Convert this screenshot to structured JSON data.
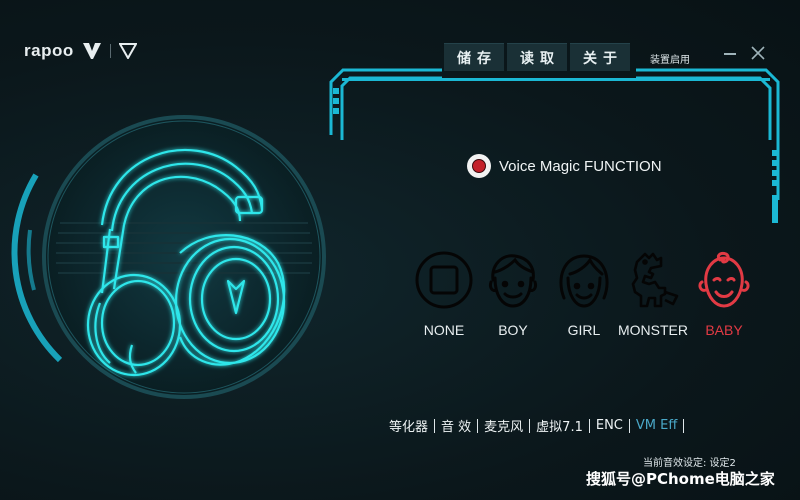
{
  "brand": {
    "name": "rapoo"
  },
  "toolbar": {
    "save_label": "储存",
    "load_label": "读取",
    "about_label": "关于",
    "device_status": "装置启用"
  },
  "voice_magic": {
    "label": "Voice Magic FUNCTION",
    "enabled": true
  },
  "presets": [
    {
      "id": "none",
      "label": "NONE",
      "icon": "none-icon",
      "selected": false
    },
    {
      "id": "boy",
      "label": "BOY",
      "icon": "boy-face-icon",
      "selected": false
    },
    {
      "id": "girl",
      "label": "GIRL",
      "icon": "girl-face-icon",
      "selected": false
    },
    {
      "id": "monster",
      "label": "MONSTER",
      "icon": "monster-icon",
      "selected": false
    },
    {
      "id": "baby",
      "label": "BABY",
      "icon": "baby-face-icon",
      "selected": true
    }
  ],
  "tabs": [
    {
      "label": "等化器",
      "active": false
    },
    {
      "label": "音 效",
      "active": false
    },
    {
      "label": "麦克风",
      "active": false
    },
    {
      "label": "虚拟7.1",
      "active": false
    },
    {
      "label": "ENC",
      "active": false
    },
    {
      "label": "VM Eff",
      "active": true
    }
  ],
  "status": {
    "current_setting": "当前音效设定: 设定2"
  },
  "watermark": "搜狐号@PChome电脑之家",
  "colors": {
    "accent": "#1bb8d4",
    "headphone_glow": "#2ee6ea",
    "selected": "#e23a44",
    "background": "#0c1a1f"
  }
}
